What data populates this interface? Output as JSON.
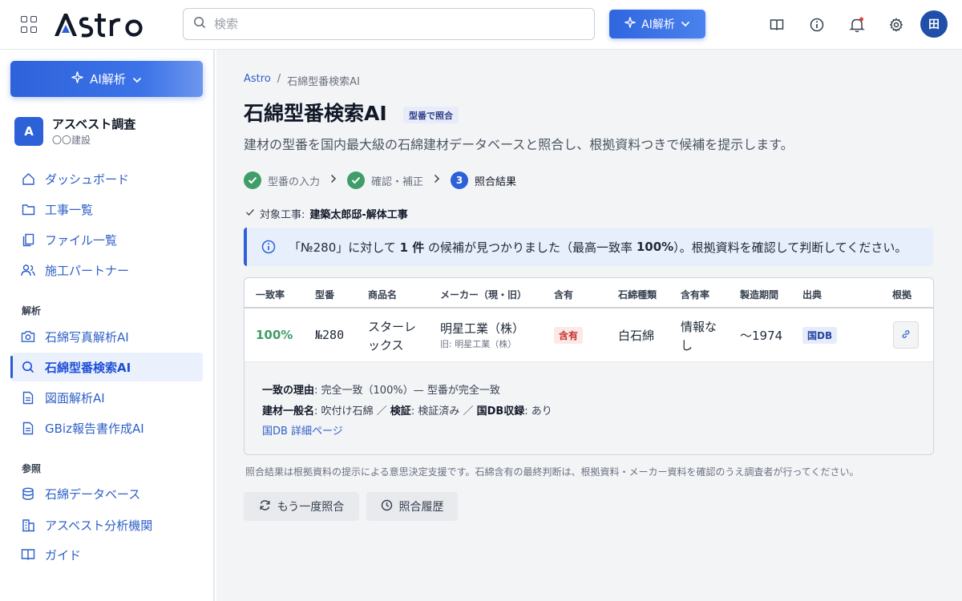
{
  "app": {
    "logo_text": "Astro"
  },
  "topbar": {
    "search_placeholder": "検索",
    "ai_button_label": "AI解析",
    "avatar_initial": "田"
  },
  "sidebar": {
    "ai_button_label": "AI解析",
    "org": {
      "initial": "A",
      "name": "アスベスト調査",
      "sub": "〇〇建設"
    },
    "items": [
      {
        "label": "ダッシュボード"
      },
      {
        "label": "工事一覧"
      },
      {
        "label": "ファイル一覧"
      },
      {
        "label": "施工パートナー"
      }
    ],
    "section_analysis": "解析",
    "analysis_items": [
      {
        "label": "石綿写真解析AI"
      },
      {
        "label": "石綿型番検索AI"
      },
      {
        "label": "図面解析AI"
      },
      {
        "label": "GBiz報告書作成AI"
      }
    ],
    "section_reference": "参照",
    "reference_items": [
      {
        "label": "石綿データベース"
      },
      {
        "label": "アスベスト分析機関"
      },
      {
        "label": "ガイド"
      }
    ]
  },
  "main": {
    "breadcrumb": {
      "root": "Astro",
      "sep": "/",
      "current": "石綿型番検索AI"
    },
    "title": "石綿型番検索AI",
    "mode_badge": "型番で照合",
    "subtitle": "建材の型番を国内最大級の石綿建材データベースと照合し、根拠資料つきで候補を提示します。",
    "steps": [
      {
        "label": "型番の入力",
        "state": "done"
      },
      {
        "label": "確認・補正",
        "state": "done"
      },
      {
        "num": "3",
        "label": "照合結果",
        "state": "current"
      }
    ],
    "target": {
      "label": "対象工事:",
      "value": "建築太郎邸-解体工事"
    },
    "info": {
      "p1": "「№280」に対して",
      "count": "1 件",
      "p2": "の候補が見つかりました（最高一致率",
      "rate": "100%",
      "p3": "）。根拠資料を確認して判断してください。"
    },
    "table": {
      "headers": [
        "一致率",
        "型番",
        "商品名",
        "メーカー（現・旧）",
        "含有",
        "石綿種類",
        "含有率",
        "製造期間",
        "出典",
        "根拠"
      ],
      "row": {
        "match": "100%",
        "model": "№280",
        "product_l1": "スターレ",
        "product_l2": "ックス",
        "maker": "明星工業（株）",
        "maker_old": "旧: 明星工業（株）",
        "contains": "含有",
        "asbestos_type": "白石綿",
        "rate_l1": "情報な",
        "rate_l2": "し",
        "period": "〜1974",
        "source": "国DB"
      },
      "detail": {
        "reason_label": "一致の理由",
        "reason_value": ": 完全一致（100%）— 型番が完全一致",
        "general_label": "建材一般名",
        "general_value": ": 吹付け石綿 ／ ",
        "verify_label": "検証",
        "verify_value": ": 検証済み ／ ",
        "db_label": "国DB収録",
        "db_value": ": あり",
        "link": "国DB 詳細ページ"
      }
    },
    "note": "照合結果は根拠資料の提示による意思決定支援です。石綿含有の最終判断は、根拠資料・メーカー資料を確認のうえ調査者が行ってください。",
    "actions": {
      "retry": "もう一度照合",
      "history": "照合履歴"
    }
  },
  "colors": {
    "accent": "#2d61d8",
    "success": "#3f9d68",
    "danger": "#c53030"
  }
}
